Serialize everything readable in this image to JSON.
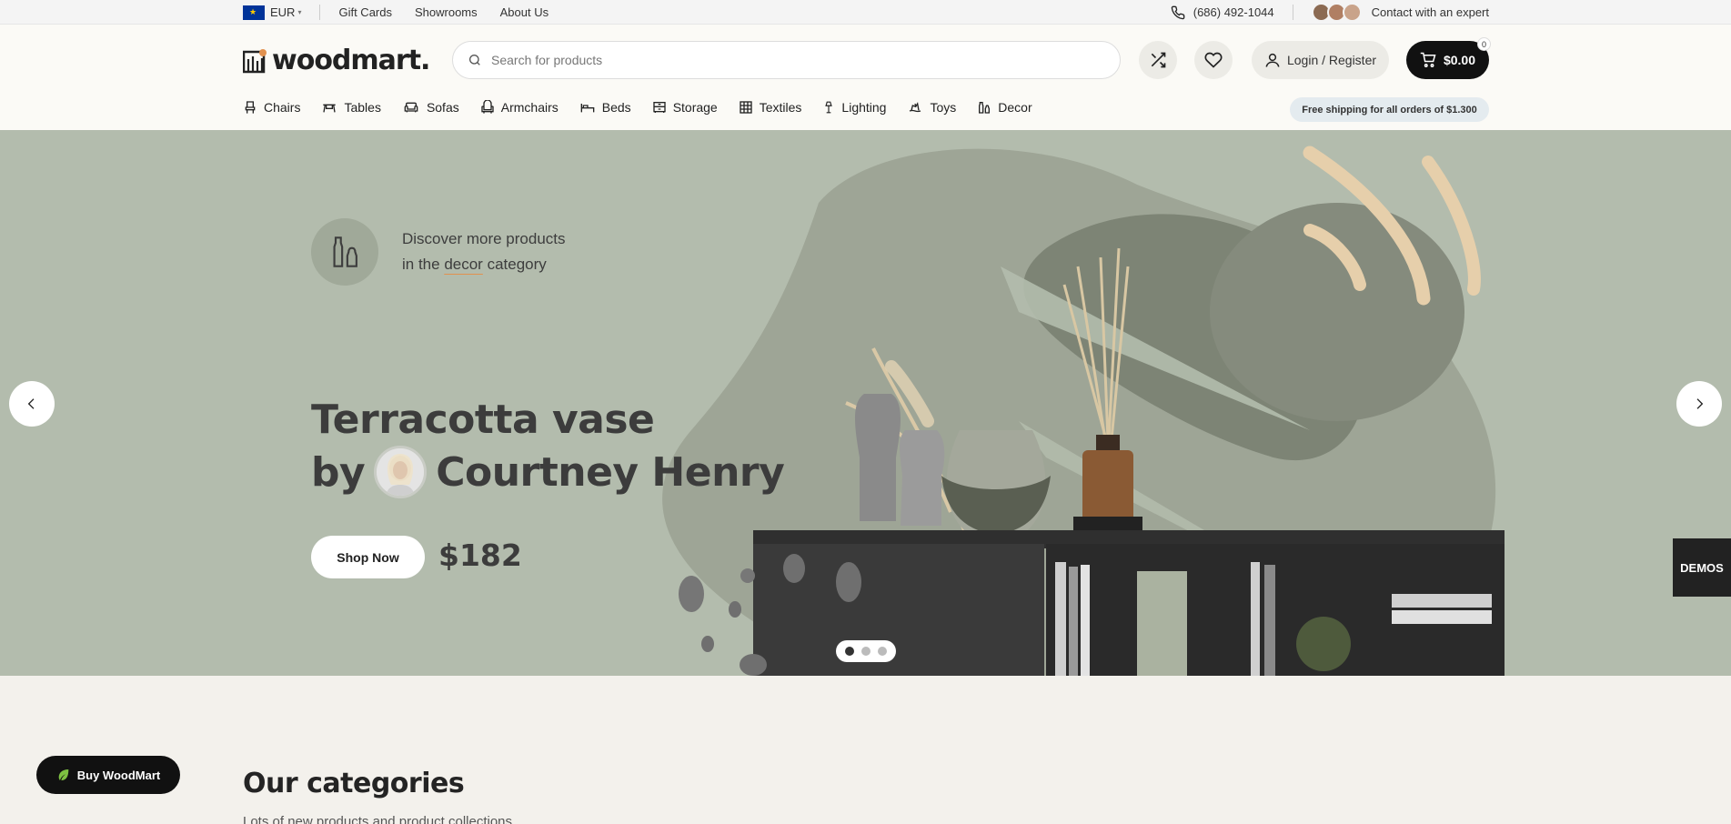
{
  "topbar": {
    "currency": "EUR",
    "links": [
      "Gift Cards",
      "Showrooms",
      "About Us"
    ],
    "phone": "(686) 492-1044",
    "contact_label": "Contact with an expert"
  },
  "header": {
    "logo_text": "woodmart.",
    "search_placeholder": "Search for products",
    "login_label": "Login / Register",
    "cart_total": "$0.00",
    "cart_count": "0"
  },
  "menu": {
    "items": [
      {
        "label": "Chairs",
        "icon": "chair-icon"
      },
      {
        "label": "Tables",
        "icon": "table-icon"
      },
      {
        "label": "Sofas",
        "icon": "sofa-icon"
      },
      {
        "label": "Armchairs",
        "icon": "armchair-icon"
      },
      {
        "label": "Beds",
        "icon": "bed-icon"
      },
      {
        "label": "Storage",
        "icon": "storage-icon"
      },
      {
        "label": "Textiles",
        "icon": "textiles-icon"
      },
      {
        "label": "Lighting",
        "icon": "lamp-icon"
      },
      {
        "label": "Toys",
        "icon": "toy-icon"
      },
      {
        "label": "Decor",
        "icon": "decor-icon"
      }
    ],
    "shipping_note": "Free shipping for all orders of $1.300"
  },
  "hero": {
    "discover_line1": "Discover more products",
    "discover_line2_pre": "in the ",
    "discover_line2_highlight": "decor",
    "discover_line2_post": " category",
    "title_line1": "Terracotta vase",
    "title_by": "by",
    "title_author": "Courtney Henry",
    "shop_button": "Shop Now",
    "price": "$182",
    "slides_total": 3,
    "active_slide": 1
  },
  "side": {
    "demos_label": "DEMOS",
    "buy_label": "Buy WoodMart"
  },
  "categories": {
    "title": "Our categories",
    "subtitle": "Lots of new products and product collections."
  },
  "colors": {
    "hero_bg": "#b3bcad",
    "accent_underline": "#e1914f",
    "dark": "#111111",
    "buy_leaf": "#7ec242"
  }
}
